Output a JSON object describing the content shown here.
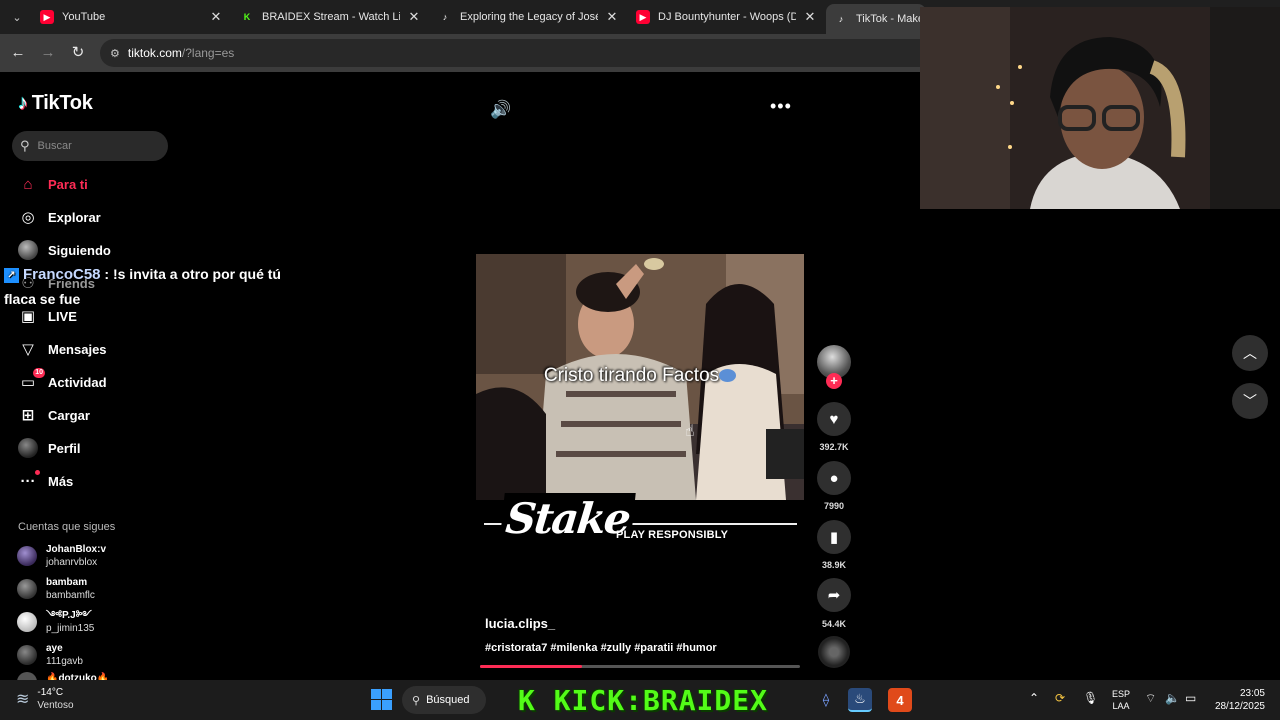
{
  "browser": {
    "tabs": [
      {
        "title": "YouTube",
        "favicon": "youtube-icon"
      },
      {
        "title": "BRAIDEX Stream - Watch Live o",
        "favicon": "kick-icon"
      },
      {
        "title": "Exploring the Legacy of José Jo",
        "favicon": "tiktok-icon"
      },
      {
        "title": "DJ Bountyhunter - Woops (Dim",
        "favicon": "youtube-icon"
      },
      {
        "title": "TikTok - Make Y",
        "favicon": "tiktok-icon"
      }
    ],
    "url_host": "tiktok.com",
    "url_rest": "/?lang=es"
  },
  "sidebar": {
    "logo": "TikTok",
    "search_placeholder": "Buscar",
    "nav": [
      {
        "label": "Para ti",
        "icon": "home-icon",
        "active": true
      },
      {
        "label": "Explorar",
        "icon": "compass-icon"
      },
      {
        "label": "Siguiendo",
        "icon": "avatar-icon"
      },
      {
        "label": "Friends",
        "icon": "friends-icon"
      },
      {
        "label": "LIVE",
        "icon": "live-tv-icon"
      },
      {
        "label": "Mensajes",
        "icon": "send-icon"
      },
      {
        "label": "Actividad",
        "icon": "inbox-icon",
        "badge": "10"
      },
      {
        "label": "Cargar",
        "icon": "upload-icon"
      },
      {
        "label": "Perfil",
        "icon": "profile-icon"
      },
      {
        "label": "Más",
        "icon": "more-dots-icon"
      }
    ],
    "following_title": "Cuentas que sigues",
    "following": [
      {
        "name": "JohanBlox:v",
        "handle": "johanrvblox"
      },
      {
        "name": "bambam",
        "handle": "bambamflc"
      },
      {
        "name": "༺P.J༻",
        "handle": "p_jimin135"
      },
      {
        "name": "aye",
        "handle": "111gavb"
      },
      {
        "name": "🔥dotzuko🔥",
        "handle": ""
      }
    ]
  },
  "chat_overlay": {
    "user": "FrancoC58",
    "message": ": !s invita a otro por qué tú flaca se fue"
  },
  "video": {
    "caption": "Cristo tirando Factos",
    "sponsor": "Stake",
    "sponsor_tagline": "PLAY RESPONSIBLY",
    "author": "lucia.clips_",
    "hashtags": "#cristorata7 #milenka #zully #paratii #humor",
    "progress": 0.32,
    "likes": "392.7K",
    "comments": "7990",
    "saves": "38.9K",
    "shares": "54.4K"
  },
  "taskbar": {
    "temperature": "-14°C",
    "weather": "Ventoso",
    "search_label": "Búsqued",
    "banner": "K KICK:BRAIDEX",
    "lang_line1": "ESP",
    "lang_line2": "LAA",
    "time": "23:05",
    "date": "28/12/2025",
    "app_badge": "4"
  },
  "colors": {
    "accent": "#fe2c55",
    "kick_green": "#53fc18",
    "background": "#000000"
  }
}
